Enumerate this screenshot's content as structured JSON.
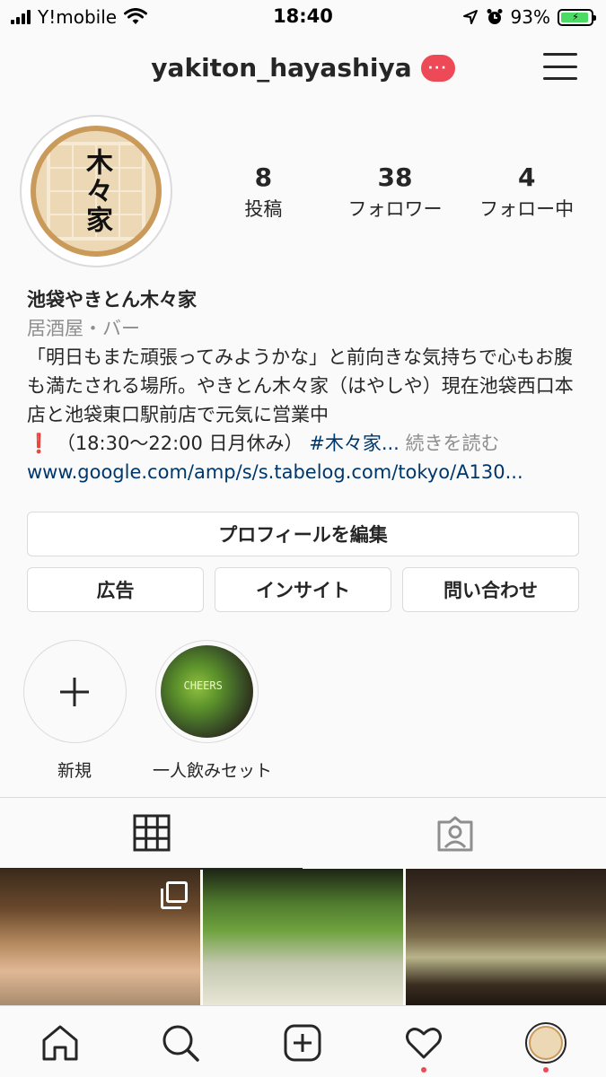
{
  "status_bar": {
    "carrier": "Y!mobile",
    "time": "18:40",
    "battery": "93%",
    "battery_level": 0.93
  },
  "header": {
    "username": "yakiton_hayashiya",
    "more_label": "···"
  },
  "profile": {
    "avatar_text": "木々家",
    "stats": [
      {
        "value": "8",
        "label": "投稿"
      },
      {
        "value": "38",
        "label": "フォロワー"
      },
      {
        "value": "4",
        "label": "フォロー中"
      }
    ],
    "name": "池袋やきとん木々家",
    "category": "居酒屋・バー",
    "bio_main": "「明日もまた頑張ってみようかな」と前向きな気持ちで心もお腹も満たされる場所。やきとん木々家（はやしや）現在池袋西口本店と池袋東口駅前店で元気に営業中",
    "bio_hours": "❗️ （18:30〜22:00 日月休み）",
    "bio_hashtag": "#木々家...",
    "read_more": "続きを読む",
    "link": "www.google.com/amp/s/s.tabelog.com/tokyo/A130..."
  },
  "buttons": {
    "edit_profile": "プロフィールを編集",
    "ads": "広告",
    "insights": "インサイト",
    "contact": "問い合わせ"
  },
  "highlights": [
    {
      "label": "新規"
    },
    {
      "label": "一人飲みセット"
    }
  ],
  "colors": {
    "link": "#00376b",
    "secondary_text": "#8e8e8e",
    "badge": "#ed4956",
    "border": "#dbdbdb"
  }
}
